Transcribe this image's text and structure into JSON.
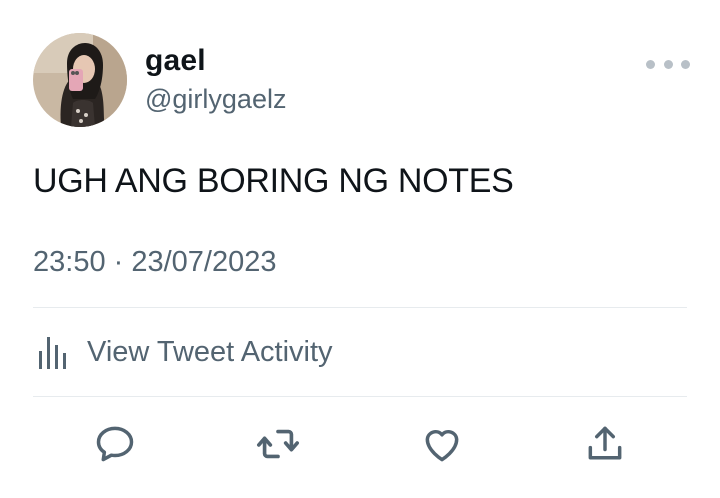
{
  "tweet": {
    "display_name": "gael",
    "handle": "@girlygaelz",
    "text": "UGH ANG BORING NG NOTES",
    "timestamp": "23:50 · 23/07/2023",
    "activity_label": "View Tweet Activity"
  },
  "icons": {
    "more": "more-horizontal-icon",
    "activity": "bar-chart-icon",
    "reply": "reply-icon",
    "retweet": "retweet-icon",
    "like": "heart-icon",
    "share": "share-icon"
  },
  "colors": {
    "text_primary": "#0f1419",
    "text_secondary": "#536471",
    "divider": "#e7ebee"
  }
}
